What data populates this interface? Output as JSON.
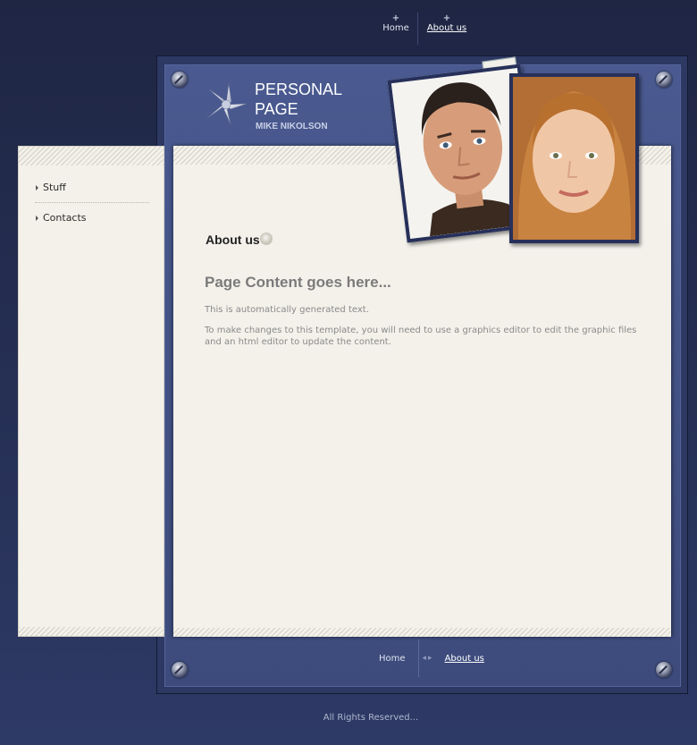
{
  "top_nav": {
    "items": [
      {
        "label": "Home",
        "active": false
      },
      {
        "label": "About us",
        "active": true
      }
    ]
  },
  "header": {
    "title": "PERSONAL PAGE",
    "subtitle": "MIKE NIKOLSON",
    "logo_icon": "star-icon"
  },
  "sidebar": {
    "items": [
      {
        "label": "Stuff"
      },
      {
        "label": "Contacts"
      }
    ]
  },
  "main": {
    "section_heading": "About us",
    "page_heading": "Page Content goes here...",
    "paragraphs": [
      "This is automatically generated text.",
      "To make changes to this template, you will need to use a graphics editor to edit the graphic files and an html editor to update the content."
    ]
  },
  "footer_nav": {
    "items": [
      {
        "label": "Home",
        "active": false
      },
      {
        "label": "About us",
        "active": true
      }
    ]
  },
  "footer": {
    "copyright": "All Rights Reserved..."
  },
  "colors": {
    "background": "#222a4a",
    "frame": "#3d4b7c",
    "panel": "#f3f1ea",
    "text": "#8a8a8a"
  }
}
